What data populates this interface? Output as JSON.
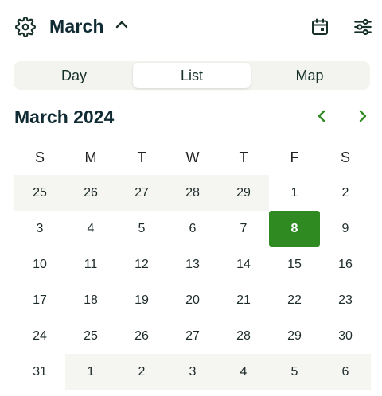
{
  "header": {
    "month_label": "March",
    "icons": {
      "settings": "gear-icon",
      "expand": "chevron-up-icon",
      "calendar": "calendar-icon",
      "filters": "sliders-icon"
    }
  },
  "view_tabs": [
    {
      "label": "Day",
      "active": false
    },
    {
      "label": "List",
      "active": true
    },
    {
      "label": "Map",
      "active": false
    }
  ],
  "calendar": {
    "title": "March 2024",
    "weekdays": [
      "S",
      "M",
      "T",
      "W",
      "T",
      "F",
      "S"
    ],
    "days": [
      {
        "label": "25",
        "muted": true
      },
      {
        "label": "26",
        "muted": true
      },
      {
        "label": "27",
        "muted": true
      },
      {
        "label": "28",
        "muted": true
      },
      {
        "label": "29",
        "muted": true
      },
      {
        "label": "1"
      },
      {
        "label": "2"
      },
      {
        "label": "3"
      },
      {
        "label": "4"
      },
      {
        "label": "5"
      },
      {
        "label": "6"
      },
      {
        "label": "7"
      },
      {
        "label": "8",
        "selected": true
      },
      {
        "label": "9"
      },
      {
        "label": "10"
      },
      {
        "label": "11"
      },
      {
        "label": "12"
      },
      {
        "label": "13"
      },
      {
        "label": "14"
      },
      {
        "label": "15"
      },
      {
        "label": "16"
      },
      {
        "label": "17"
      },
      {
        "label": "18"
      },
      {
        "label": "19"
      },
      {
        "label": "20"
      },
      {
        "label": "21"
      },
      {
        "label": "22"
      },
      {
        "label": "23"
      },
      {
        "label": "24"
      },
      {
        "label": "25"
      },
      {
        "label": "26"
      },
      {
        "label": "27"
      },
      {
        "label": "28"
      },
      {
        "label": "29"
      },
      {
        "label": "30"
      },
      {
        "label": "31"
      },
      {
        "label": "1",
        "muted": true
      },
      {
        "label": "2",
        "muted": true
      },
      {
        "label": "3",
        "muted": true
      },
      {
        "label": "4",
        "muted": true
      },
      {
        "label": "5",
        "muted": true
      },
      {
        "label": "6",
        "muted": true
      }
    ]
  },
  "colors": {
    "accent": "#2f8a22",
    "muted_bg": "#f5f5f1",
    "title": "#102b33"
  }
}
